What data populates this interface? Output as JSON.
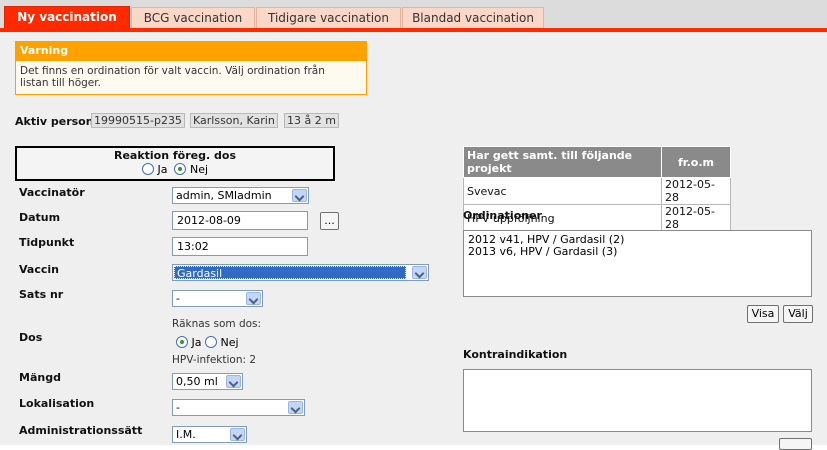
{
  "tabs": [
    {
      "label": "Ny vaccination",
      "active": true
    },
    {
      "label": "BCG vaccination",
      "active": false
    },
    {
      "label": "Tidigare vaccination",
      "active": false
    },
    {
      "label": "Blandad vaccination",
      "active": false
    }
  ],
  "warning": {
    "title": "Varning",
    "line1": "Det finns en ordination för valt vaccin. Välj ordination från",
    "line2": "listan till höger."
  },
  "person": {
    "label": "Aktiv person",
    "id": "19990515-p235",
    "name": "Karlsson, Karin",
    "age": "13 å 2 m"
  },
  "reaction": {
    "label": "Reaktion föreg. dos",
    "option_yes": "Ja",
    "option_no": "Nej",
    "selected": "Nej"
  },
  "form": {
    "vaccinator_label": "Vaccinatör",
    "vaccinator_value": "admin, SMIadmin",
    "date_label": "Datum",
    "date_value": "2012-08-09",
    "date_button": "...",
    "time_label": "Tidpunkt",
    "time_value": "13:02",
    "vaccine_label": "Vaccin",
    "vaccine_value": "Gardasil",
    "batch_label": "Sats nr",
    "batch_value": "-",
    "dose_label": "Dos",
    "counts_as_dose": "Räknas som dos:",
    "dose_yes": "Ja",
    "dose_no": "Nej",
    "hpv_infection": "HPV-infektion: 2",
    "amount_label": "Mängd",
    "amount_value": "0,50 ml",
    "localization_label": "Lokalisation",
    "localization_value": "-",
    "admin_label": "Administrationssätt",
    "admin_value": "I.M."
  },
  "projects": {
    "header_project": "Har gett samt. till följande projekt",
    "header_from": "fr.o.m",
    "rows": [
      {
        "project": "Svevac",
        "from": "2012-05-28"
      },
      {
        "project": "HPV uppföljning",
        "from": "2012-05-28"
      }
    ]
  },
  "ordinations": {
    "label": "Ordinationer",
    "items": [
      "2012 v41, HPV / Gardasil (2)",
      "2013 v6, HPV / Gardasil (3)"
    ],
    "show_button": "Visa",
    "choose_button": "Välj"
  },
  "contraindication": {
    "label": "Kontraindikation",
    "value": ""
  },
  "colors": {
    "accent": "#ff2a00",
    "warning": "#ffa200",
    "selection": "#316ac5"
  }
}
